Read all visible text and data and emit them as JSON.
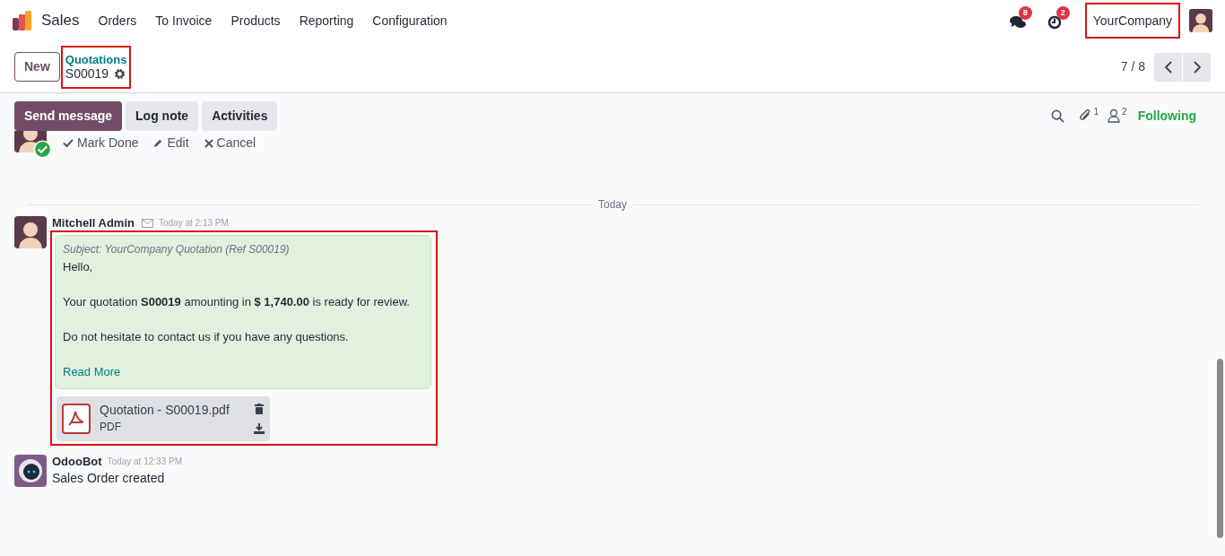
{
  "app": {
    "name": "Sales"
  },
  "menu": [
    "Orders",
    "To Invoice",
    "Products",
    "Reporting",
    "Configuration"
  ],
  "systray": [
    {
      "kind": "chat",
      "badge": "8"
    },
    {
      "kind": "activity",
      "badge": "2"
    }
  ],
  "company": {
    "name": "YourCompany",
    "highlighted": true
  },
  "control": {
    "new_button": "New",
    "breadcrumb": "Quotations",
    "record": "S00019",
    "highlighted": true,
    "pager": "7 / 8"
  },
  "chatter_buttons": [
    {
      "label": "Send message",
      "selected": true
    },
    {
      "label": "Log note",
      "selected": false
    },
    {
      "label": "Activities",
      "selected": false
    }
  ],
  "chatter_counts": {
    "attachments": "1",
    "followers": "2",
    "follow": "Following"
  },
  "activity_actions": [
    {
      "kind": "done",
      "label": "Mark Done"
    },
    {
      "kind": "edit",
      "label": "Edit"
    },
    {
      "kind": "cancel",
      "label": "Cancel"
    }
  ],
  "separator": "Today",
  "messages": [
    {
      "kind": "email",
      "author": "Mitchell Admin",
      "time": "Today at 2:13 PM",
      "highlighted": true,
      "subject": "Subject: YourCompany Quotation (Ref S00019)",
      "paragraphs": [
        "Hello,",
        "Your quotation **S00019** amounting in **$ 1,740.00** is ready for review.",
        "Do not hesitate to contact us if you have any questions."
      ],
      "link": "Read More",
      "attachment": {
        "name": "Quotation - S00019.pdf",
        "type": "PDF"
      }
    },
    {
      "kind": "note",
      "author": "OdooBot",
      "time": "Today at 12:33 PM",
      "paragraphs": [
        "Sales Order created"
      ]
    }
  ]
}
